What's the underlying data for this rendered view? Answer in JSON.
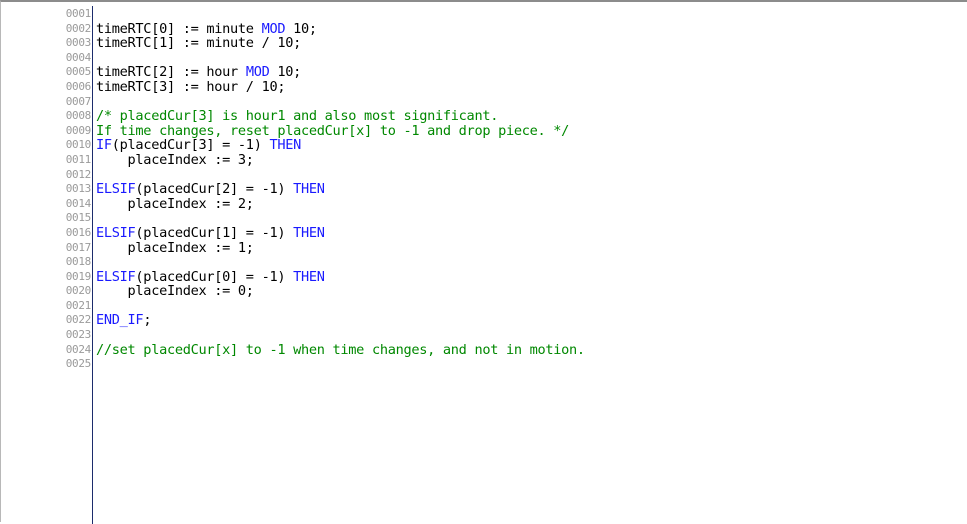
{
  "editor": {
    "colors": {
      "plain": "#000000",
      "keyword": "#1a1aff",
      "comment": "#008800",
      "line_number": "#9a9a9a"
    },
    "lines": [
      {
        "number": "0001",
        "tokens": []
      },
      {
        "number": "0002",
        "tokens": [
          {
            "t": "timeRTC[0] := minute ",
            "c": "plain"
          },
          {
            "t": "MOD",
            "c": "keyword"
          },
          {
            "t": " 10;",
            "c": "plain"
          }
        ]
      },
      {
        "number": "0003",
        "tokens": [
          {
            "t": "timeRTC[1] := minute / 10;",
            "c": "plain"
          }
        ]
      },
      {
        "number": "0004",
        "tokens": []
      },
      {
        "number": "0005",
        "tokens": [
          {
            "t": "timeRTC[2] := hour ",
            "c": "plain"
          },
          {
            "t": "MOD",
            "c": "keyword"
          },
          {
            "t": " 10;",
            "c": "plain"
          }
        ]
      },
      {
        "number": "0006",
        "tokens": [
          {
            "t": "timeRTC[3] := hour / 10;",
            "c": "plain"
          }
        ]
      },
      {
        "number": "0007",
        "tokens": []
      },
      {
        "number": "0008",
        "tokens": [
          {
            "t": "/* placedCur[3] is hour1 and also most significant.",
            "c": "comment"
          }
        ]
      },
      {
        "number": "0009",
        "tokens": [
          {
            "t": "If time changes, reset placedCur[x] to -1 and drop piece. */",
            "c": "comment"
          }
        ]
      },
      {
        "number": "0010",
        "tokens": [
          {
            "t": "IF",
            "c": "keyword"
          },
          {
            "t": "(placedCur[3] = -1) ",
            "c": "plain"
          },
          {
            "t": "THEN",
            "c": "keyword"
          }
        ]
      },
      {
        "number": "0011",
        "tokens": [
          {
            "t": "    placeIndex := 3;",
            "c": "plain"
          }
        ]
      },
      {
        "number": "0012",
        "tokens": []
      },
      {
        "number": "0013",
        "tokens": [
          {
            "t": "ELSIF",
            "c": "keyword"
          },
          {
            "t": "(placedCur[2] = -1) ",
            "c": "plain"
          },
          {
            "t": "THEN",
            "c": "keyword"
          }
        ]
      },
      {
        "number": "0014",
        "tokens": [
          {
            "t": "    placeIndex := 2;",
            "c": "plain"
          }
        ]
      },
      {
        "number": "0015",
        "tokens": []
      },
      {
        "number": "0016",
        "tokens": [
          {
            "t": "ELSIF",
            "c": "keyword"
          },
          {
            "t": "(placedCur[1] = -1) ",
            "c": "plain"
          },
          {
            "t": "THEN",
            "c": "keyword"
          }
        ]
      },
      {
        "number": "0017",
        "tokens": [
          {
            "t": "    placeIndex := 1;",
            "c": "plain"
          }
        ]
      },
      {
        "number": "0018",
        "tokens": []
      },
      {
        "number": "0019",
        "tokens": [
          {
            "t": "ELSIF",
            "c": "keyword"
          },
          {
            "t": "(placedCur[0] = -1) ",
            "c": "plain"
          },
          {
            "t": "THEN",
            "c": "keyword"
          }
        ]
      },
      {
        "number": "0020",
        "tokens": [
          {
            "t": "    placeIndex := 0;",
            "c": "plain"
          }
        ]
      },
      {
        "number": "0021",
        "tokens": []
      },
      {
        "number": "0022",
        "tokens": [
          {
            "t": "END_IF",
            "c": "keyword"
          },
          {
            "t": ";",
            "c": "plain"
          }
        ]
      },
      {
        "number": "0023",
        "tokens": []
      },
      {
        "number": "0024",
        "tokens": [
          {
            "t": "//set placedCur[x] to -1 when time changes, and not in motion.",
            "c": "comment"
          }
        ]
      },
      {
        "number": "0025",
        "tokens": []
      }
    ]
  }
}
